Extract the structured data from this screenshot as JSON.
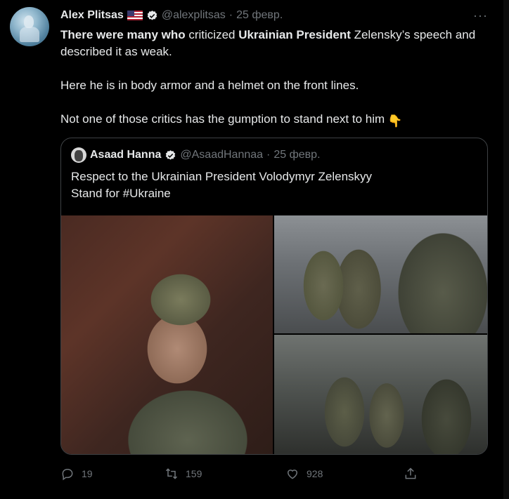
{
  "tweet": {
    "author": {
      "name": "Alex Plitsas",
      "handle": "@alexplitsas",
      "separator": "·",
      "date": "25 февр."
    },
    "more_label": "···",
    "body": {
      "line1": [
        {
          "text": "There were many who",
          "bold": true
        },
        {
          "text": " criticized ",
          "bold": false
        },
        {
          "text": "Ukrainian President",
          "bold": true
        },
        {
          "text": " Zelensky’s speech and described it as weak.",
          "bold": false
        }
      ],
      "line2": "Here he is in body armor and a helmet on the front lines.",
      "line3": "Not one of those critics has the gumption to stand next to him",
      "emoji": "👇"
    },
    "quoted": {
      "author": {
        "name": "Asaad Hanna",
        "handle": "@AsaadHannaa",
        "separator": "·",
        "date": "25 февр."
      },
      "text_line1": "Respect to the Ukrainian President Volodymyr Zelenskyy",
      "text_line2": "Stand for #Ukraine"
    },
    "actions": {
      "replies": "19",
      "retweets": "159",
      "likes": "928"
    }
  },
  "icons": {
    "verified": "verified-icon",
    "flag": "us-flag-icon",
    "reply": "reply-icon",
    "retweet": "retweet-icon",
    "like": "heart-icon",
    "share": "share-icon"
  },
  "colors": {
    "background": "#000000",
    "text": "#e7e9ea",
    "muted": "#71767b",
    "border": "#3e4144"
  }
}
